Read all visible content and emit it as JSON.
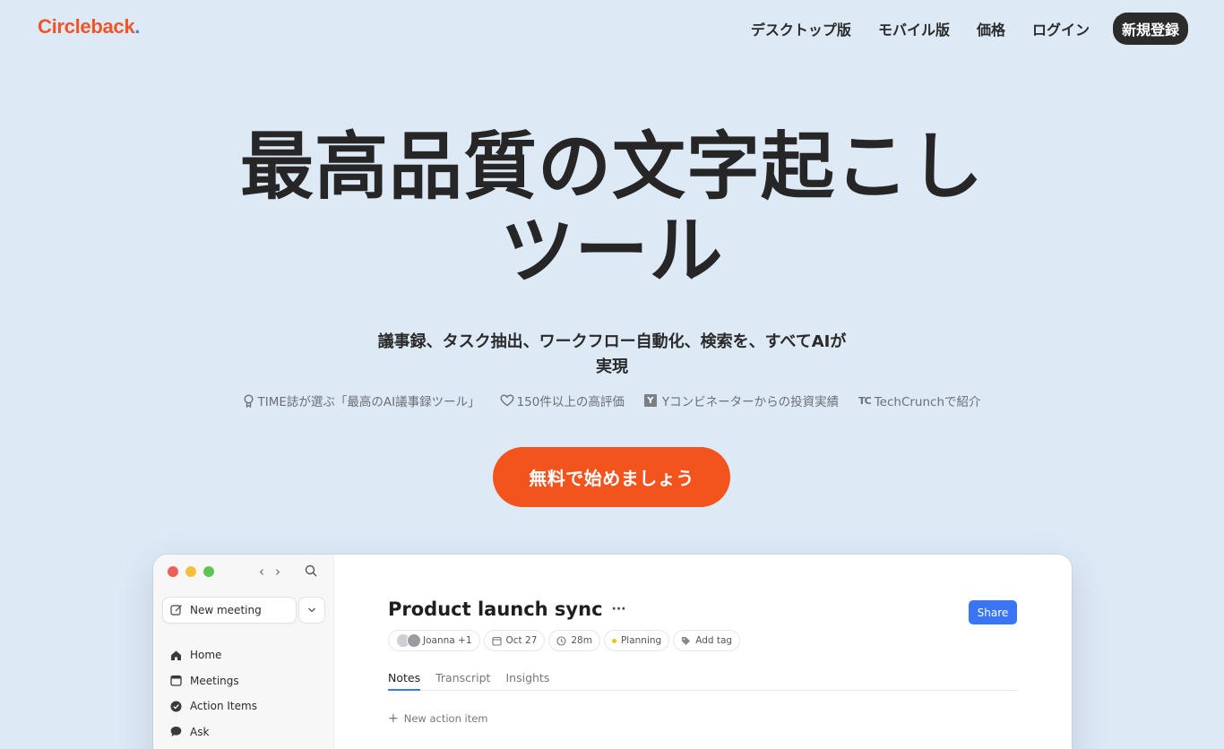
{
  "header": {
    "logo_text": "Circleback",
    "logo_dot": ".",
    "nav": [
      "デスクトップ版",
      "モバイル版",
      "価格",
      "ログイン"
    ],
    "signup_label": "新規登録"
  },
  "hero": {
    "title_line1": "最高品質の文字起こし",
    "title_line2": "ツール",
    "subtitle_line1": "議事録、タスク抽出、ワークフロー自動化、検索を、すべてAIが",
    "subtitle_line2": "実現",
    "badges": {
      "time": "TIME誌が選ぶ「最高のAI議事録ツール」",
      "reviews": "150件以上の高評価",
      "yc_letter": "Y",
      "yc": "Yコンビネーターからの投資実績",
      "tc_mark": "TC",
      "techcrunch": "TechCrunchで紹介"
    },
    "cta_label": "無料で始めましょう"
  },
  "app": {
    "new_meeting_label": "New meeting",
    "sidebar_items": [
      "Home",
      "Meetings",
      "Action Items",
      "Ask"
    ],
    "doc_title": "Product launch sync",
    "more": "···",
    "share_label": "Share",
    "chips": {
      "attendees": "Joanna +1",
      "date": "Oct 27",
      "duration": "28m",
      "status": "Planning",
      "add_tag": "Add tag"
    },
    "tabs": [
      "Notes",
      "Transcript",
      "Insights"
    ],
    "new_action_label": "New action item"
  },
  "colors": {
    "background": "#dde9f5",
    "brand": "#f0552a",
    "cta": "#f3531c",
    "share": "#3a75f6"
  }
}
